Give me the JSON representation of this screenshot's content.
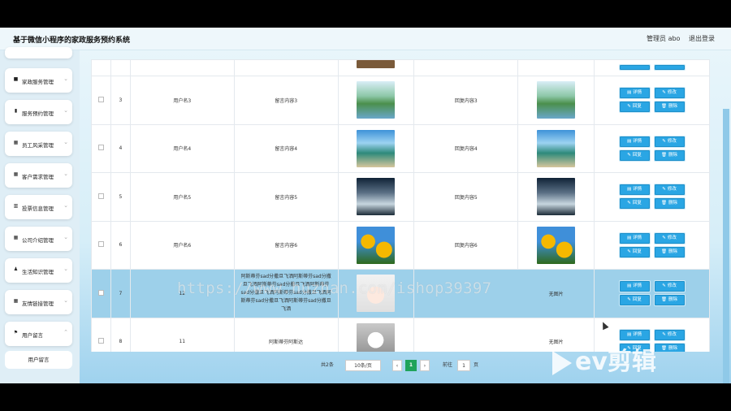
{
  "app": {
    "title": "基于微信小程序的家政服务预约系统"
  },
  "header": {
    "admin_label": "管理员 abo",
    "logout_label": "退出登录"
  },
  "sidebar": {
    "items": [
      {
        "label": "家政服务管理",
        "icon": "doc-icon"
      },
      {
        "label": "服务预约管理",
        "icon": "chart-icon"
      },
      {
        "label": "员工风采管理",
        "icon": "grid-icon"
      },
      {
        "label": "客户需求管理",
        "icon": "grid-icon"
      },
      {
        "label": "投票信息管理",
        "icon": "bar-icon"
      },
      {
        "label": "公司介绍管理",
        "icon": "grid-icon"
      },
      {
        "label": "生活知识管理",
        "icon": "user-icon"
      },
      {
        "label": "友情链接管理",
        "icon": "grid-icon"
      },
      {
        "label": "用户留言",
        "icon": "flag-icon"
      }
    ],
    "sub_item": "用户留言"
  },
  "table": {
    "rows": [
      {
        "index": "3",
        "user": "用户名3",
        "content": "留言内容3",
        "reply": "回复内容3",
        "image": "lake"
      },
      {
        "index": "4",
        "user": "用户名4",
        "content": "留言内容4",
        "reply": "回复内容4",
        "image": "hut"
      },
      {
        "index": "5",
        "user": "用户名5",
        "content": "留言内容5",
        "reply": "回复内容5",
        "image": "river"
      },
      {
        "index": "6",
        "user": "用户名6",
        "content": "留言内容6",
        "reply": "回复内容6",
        "image": "flower"
      },
      {
        "index": "7",
        "user": "12",
        "content": "阿斯蒂芬sad分撒旦飞洒阿斯蒂芬sad分撒旦飞洒阿斯蒂芬sad分撒旦飞洒阿斯蒂芬sad分撒旦飞洒阿斯蒂芬sad分撒旦飞洒阿斯蒂芬sad分撒旦飞洒阿斯蒂芬sad分撒旦飞洒",
        "reply": "无图片",
        "image": "girl"
      },
      {
        "index": "8",
        "user": "11",
        "content": "阿斯蒂芬阿斯达",
        "reply": "无图片",
        "image": "boy"
      }
    ],
    "buttons": {
      "detail": "详情",
      "edit": "修改",
      "reply": "回复",
      "delete": "删除"
    }
  },
  "pagination": {
    "total_label": "共2条",
    "page_size": "10条/页",
    "current_page": "1",
    "goto_label": "前往",
    "goto_value": "1",
    "page_unit": "页"
  },
  "overlay": {
    "watermark": "https://www.huzhan.com/ishop39397",
    "logo": "ev剪辑"
  }
}
